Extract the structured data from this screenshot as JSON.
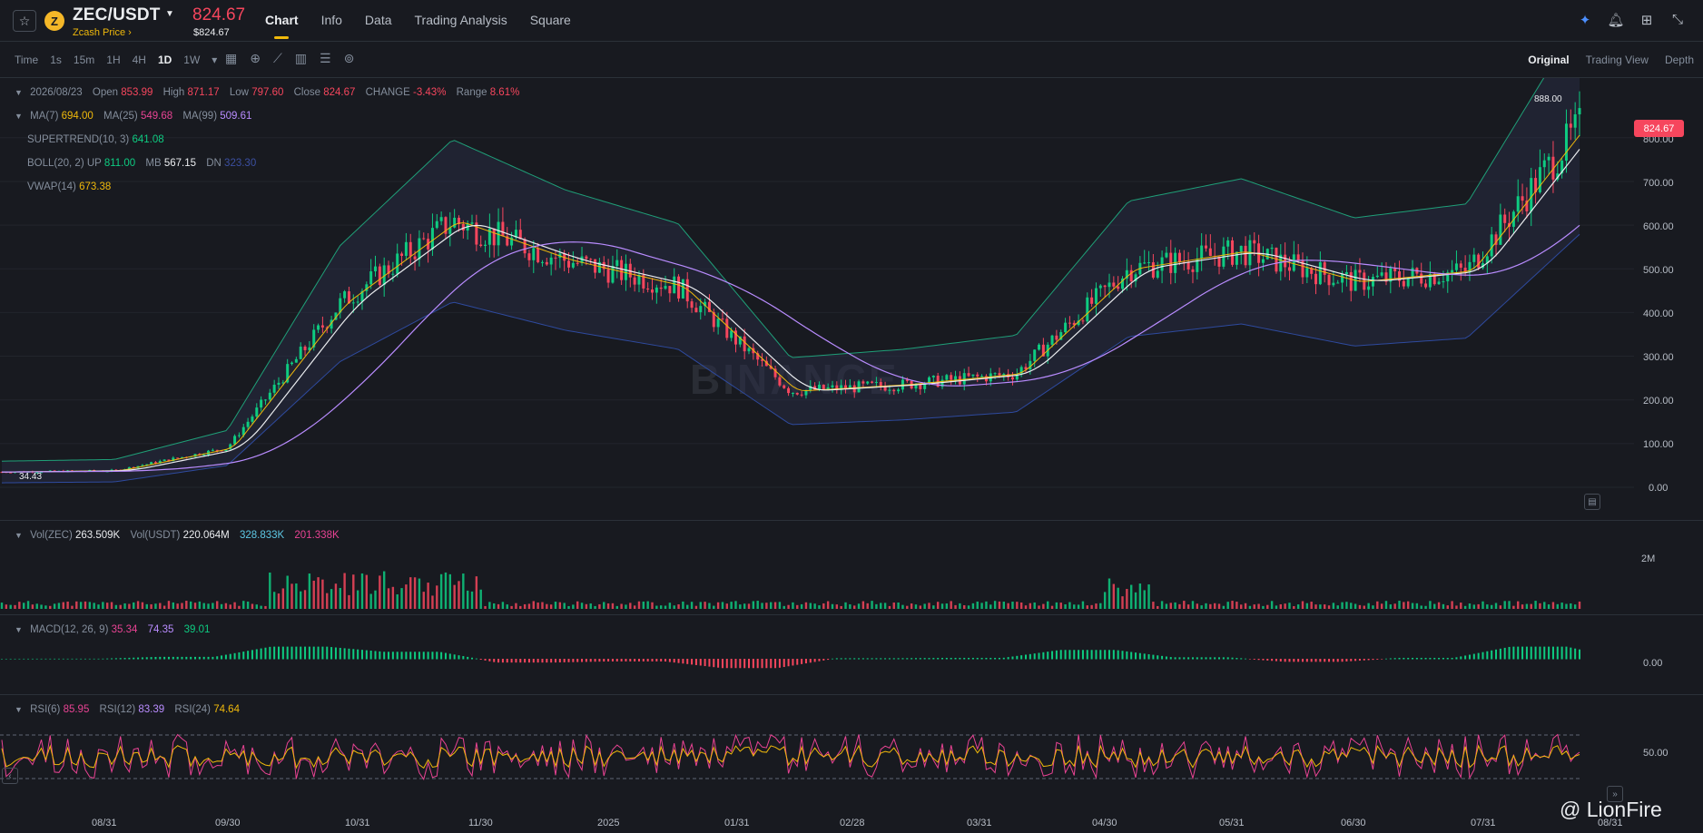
{
  "header": {
    "favorite_icon": "star-icon",
    "coin_logo_letter": "Z",
    "pair": "ZEC/USDT",
    "subname": "Zcash Price ›",
    "price": "824.67",
    "price_usd": "$824.67",
    "tabs": [
      "Chart",
      "Info",
      "Data",
      "Trading Analysis",
      "Square"
    ],
    "active_tab": "Chart",
    "right_icons": [
      "ai-sparkle-icon",
      "bell-icon",
      "layout-grid-icon",
      "collapse-icon"
    ]
  },
  "toolbar": {
    "timeframes": [
      "Time",
      "1s",
      "15m",
      "1H",
      "4H",
      "1D",
      "1W"
    ],
    "active_timeframe": "1D",
    "tool_icons": [
      "calendar-icon",
      "crosshair-icon",
      "indicator-icon",
      "candle-type-icon",
      "settings-icon",
      "layers-icon"
    ],
    "views": [
      "Original",
      "Trading View",
      "Depth"
    ],
    "active_view": "Original"
  },
  "main_legend": {
    "date": "2026/08/23",
    "open_label": "Open",
    "open": "853.99",
    "high_label": "High",
    "high": "871.17",
    "low_label": "Low",
    "low": "797.60",
    "close_label": "Close",
    "close": "824.67",
    "change_label": "CHANGE",
    "change": "-3.43%",
    "range_label": "Range",
    "range": "8.61%",
    "ma7_label": "MA(7)",
    "ma7": "694.00",
    "ma25_label": "MA(25)",
    "ma25": "549.68",
    "ma99_label": "MA(99)",
    "ma99": "509.61",
    "st_label": "SUPERTREND(10, 3)",
    "st": "641.08",
    "boll_label": "BOLL(20, 2)",
    "up_label": "UP",
    "up": "811.00",
    "mb_label": "MB",
    "mb": "567.15",
    "dn_label": "DN",
    "dn": "323.30",
    "vwap_label": "VWAP(14)",
    "vwap": "673.38"
  },
  "price_axis": [
    "800.00",
    "700.00",
    "600.00",
    "500.00",
    "400.00",
    "300.00",
    "200.00",
    "100.00",
    "0.00"
  ],
  "current_price_tag": "824.67",
  "high_marker": "888.00",
  "low_marker": "34.43",
  "watermark": "BINANCE",
  "volume_legend": {
    "vol_zec_label": "Vol(ZEC)",
    "vol_zec": "263.509K",
    "vol_usdt_label": "Vol(USDT)",
    "vol_usdt": "220.064M",
    "ma1": "328.833K",
    "ma2": "201.338K",
    "axis": "2M"
  },
  "macd_legend": {
    "label": "MACD(12, 26, 9)",
    "dif": "35.34",
    "dea": "74.35",
    "macd": "39.01",
    "axis": "0.00"
  },
  "rsi_legend": {
    "rsi6_label": "RSI(6)",
    "rsi6": "85.95",
    "rsi12_label": "RSI(12)",
    "rsi12": "83.39",
    "rsi24_label": "RSI(24)",
    "rsi24": "74.64",
    "axis": "50.00"
  },
  "x_axis": [
    "08/31",
    "09/30",
    "10/31",
    "11/30",
    "2025",
    "01/31",
    "02/28",
    "03/31",
    "04/30",
    "05/31",
    "06/30",
    "07/31",
    "08/31"
  ],
  "watermark_user": "@ LionFire",
  "colors": {
    "up": "#0ecb81",
    "down": "#f6465d",
    "ma7": "#f0b90b",
    "ma25": "#eaecef",
    "ma99": "#b98cff",
    "accent": "#f0b90b"
  },
  "chart_data": {
    "type": "candlestick",
    "title": "",
    "x_dates": [
      "08/31",
      "09/30",
      "10/31",
      "11/30",
      "2025",
      "01/31",
      "02/28",
      "03/31",
      "04/30",
      "05/31",
      "06/30",
      "07/31",
      "08/23"
    ],
    "approx_close": [
      35,
      38,
      90,
      420,
      610,
      520,
      460,
      220,
      235,
      260,
      500,
      540,
      470,
      495,
      825
    ],
    "ylim": [
      0,
      900
    ],
    "current": 824.67,
    "high": 888.0,
    "low": 34.43
  }
}
